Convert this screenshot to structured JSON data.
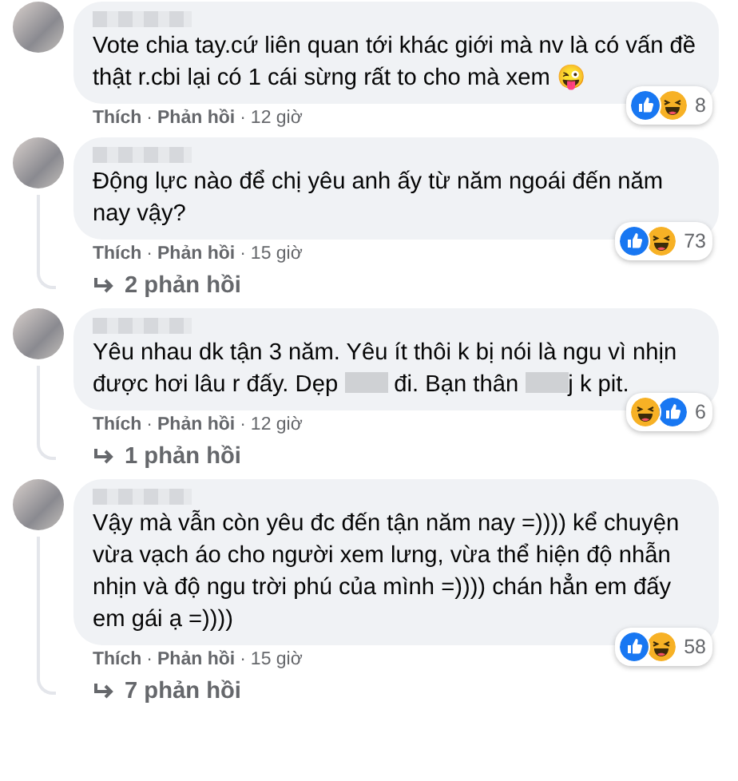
{
  "separator": "·",
  "comments": [
    {
      "text": [
        {
          "kind": "text",
          "text": "Vote chia tay.cứ liên quan tới khác giới mà nv là có vấn đề thật r.cbi lại có 1 cái sừng rất to cho mà xem 😜"
        }
      ],
      "reactions": [
        {
          "kind": "like"
        },
        {
          "kind": "haha"
        }
      ],
      "reaction_count": "8",
      "actions": [
        "Thích",
        "Phản hồi"
      ],
      "time": "12 giờ"
    },
    {
      "text": [
        {
          "kind": "text",
          "text": "Động lực nào để chị yêu anh ấy từ năm ngoái đến năm nay vậy?"
        }
      ],
      "reactions": [
        {
          "kind": "like"
        },
        {
          "kind": "haha"
        }
      ],
      "reaction_count": "73",
      "actions": [
        "Thích",
        "Phản hồi"
      ],
      "time": "15 giờ",
      "replies": "2 phản hồi"
    },
    {
      "text": [
        {
          "kind": "text",
          "text": "Yêu nhau dk tận 3 năm. Yêu ít thôi k bị nói là ngu vì nhịn được hơi lâu r đấy. Dẹp "
        },
        {
          "kind": "blur"
        },
        {
          "kind": "text",
          "text": " đi. Bạn thân "
        },
        {
          "kind": "blur"
        },
        {
          "kind": "text",
          "text": "j k pit."
        }
      ],
      "reactions": [
        {
          "kind": "haha"
        },
        {
          "kind": "like"
        }
      ],
      "reaction_count": "6",
      "actions": [
        "Thích",
        "Phản hồi"
      ],
      "time": "12 giờ",
      "replies": "1 phản hồi"
    },
    {
      "text": [
        {
          "kind": "text",
          "text": "Vậy mà vẫn còn yêu đc đến tận năm nay =)))) kể chuyện vừa vạch áo cho người xem lưng, vừa thể hiện độ nhẫn nhịn và độ ngu trời phú của mình =)))) chán hẳn em đấy em gái ạ =))))"
        }
      ],
      "reactions": [
        {
          "kind": "like"
        },
        {
          "kind": "haha"
        }
      ],
      "reaction_count": "58",
      "actions": [
        "Thích",
        "Phản hồi"
      ],
      "time": "15 giờ",
      "replies": "7 phản hồi"
    }
  ]
}
